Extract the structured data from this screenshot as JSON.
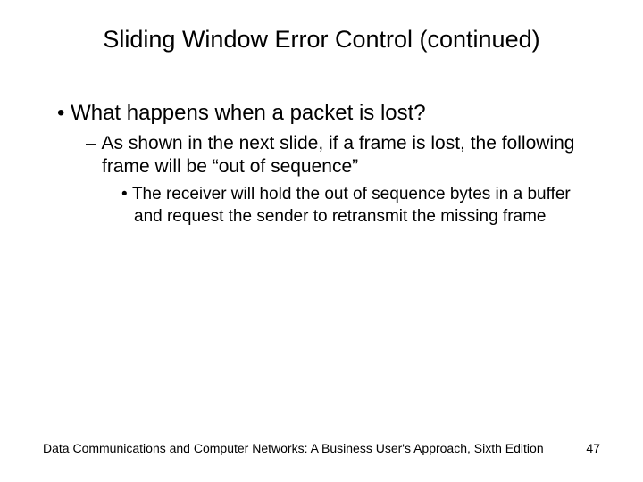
{
  "title": "Sliding Window Error Control (continued)",
  "bullets": {
    "l1": "What happens when a packet is lost?",
    "l2": "As shown in the next slide, if a frame is lost, the following frame will be “out of sequence”",
    "l3": "The receiver will hold the out of sequence bytes in a buffer and request the sender to retransmit the missing frame"
  },
  "footer": {
    "source": "Data Communications and Computer Networks: A Business User's Approach, Sixth Edition",
    "page": "47"
  }
}
